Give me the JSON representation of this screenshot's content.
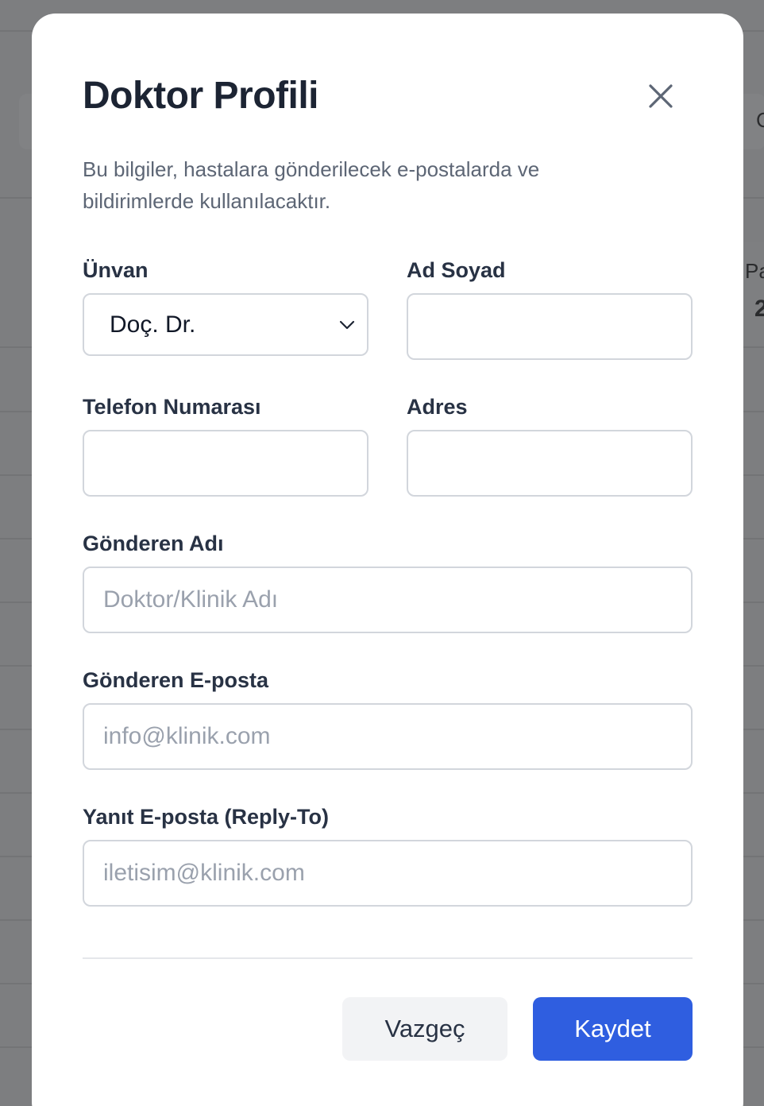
{
  "background": {
    "peek_letter_top": "C",
    "peek_label": "Pa",
    "peek_value": "2"
  },
  "modal": {
    "title": "Doktor Profili",
    "close_icon": "close-icon",
    "description": "Bu bilgiler, hastalara gönderilecek e-postalarda ve bildirimlerde kullanılacaktır."
  },
  "form": {
    "title_label": "Ünvan",
    "title_value": "Doç. Dr.",
    "fullname_label": "Ad Soyad",
    "fullname_value": "",
    "phone_label": "Telefon Numarası",
    "phone_value": "",
    "address_label": "Adres",
    "address_value": "",
    "sender_name_label": "Gönderen Adı",
    "sender_name_placeholder": "Doktor/Klinik Adı",
    "sender_email_label": "Gönderen E-posta",
    "sender_email_placeholder": "info@klinik.com",
    "reply_to_label": "Yanıt E-posta (Reply-To)",
    "reply_to_placeholder": "iletisim@klinik.com"
  },
  "actions": {
    "cancel_label": "Vazgeç",
    "save_label": "Kaydet"
  },
  "colors": {
    "primary": "#2f5ee0",
    "overlay": "#7a7b7d",
    "title_text": "#1c2433",
    "muted_text": "#5d6675"
  }
}
